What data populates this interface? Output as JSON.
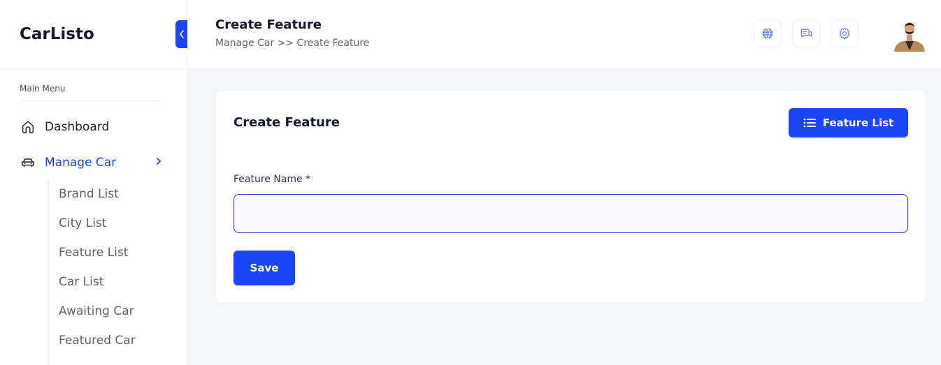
{
  "app": {
    "brand": "CarListo"
  },
  "sidebar": {
    "menu_label": "Main Menu",
    "items": [
      {
        "label": "Dashboard",
        "icon": "home-icon"
      },
      {
        "label": "Manage Car",
        "icon": "car-icon",
        "expanded": true
      }
    ],
    "submenu": [
      {
        "label": "Brand List"
      },
      {
        "label": "City List"
      },
      {
        "label": "Feature List"
      },
      {
        "label": "Car List"
      },
      {
        "label": "Awaiting Car"
      },
      {
        "label": "Featured Car"
      }
    ]
  },
  "header": {
    "title": "Create Feature",
    "breadcrumb": "Manage Car >> Create Feature",
    "icons": [
      "globe-icon",
      "chat-icon",
      "gear-icon"
    ]
  },
  "card": {
    "title": "Create Feature",
    "list_button": "Feature List",
    "field_label": "Feature Name *",
    "field_value": "",
    "field_placeholder": "",
    "save_button": "Save"
  },
  "colors": {
    "accent": "#1a46f5",
    "background": "#f4f6fa"
  }
}
